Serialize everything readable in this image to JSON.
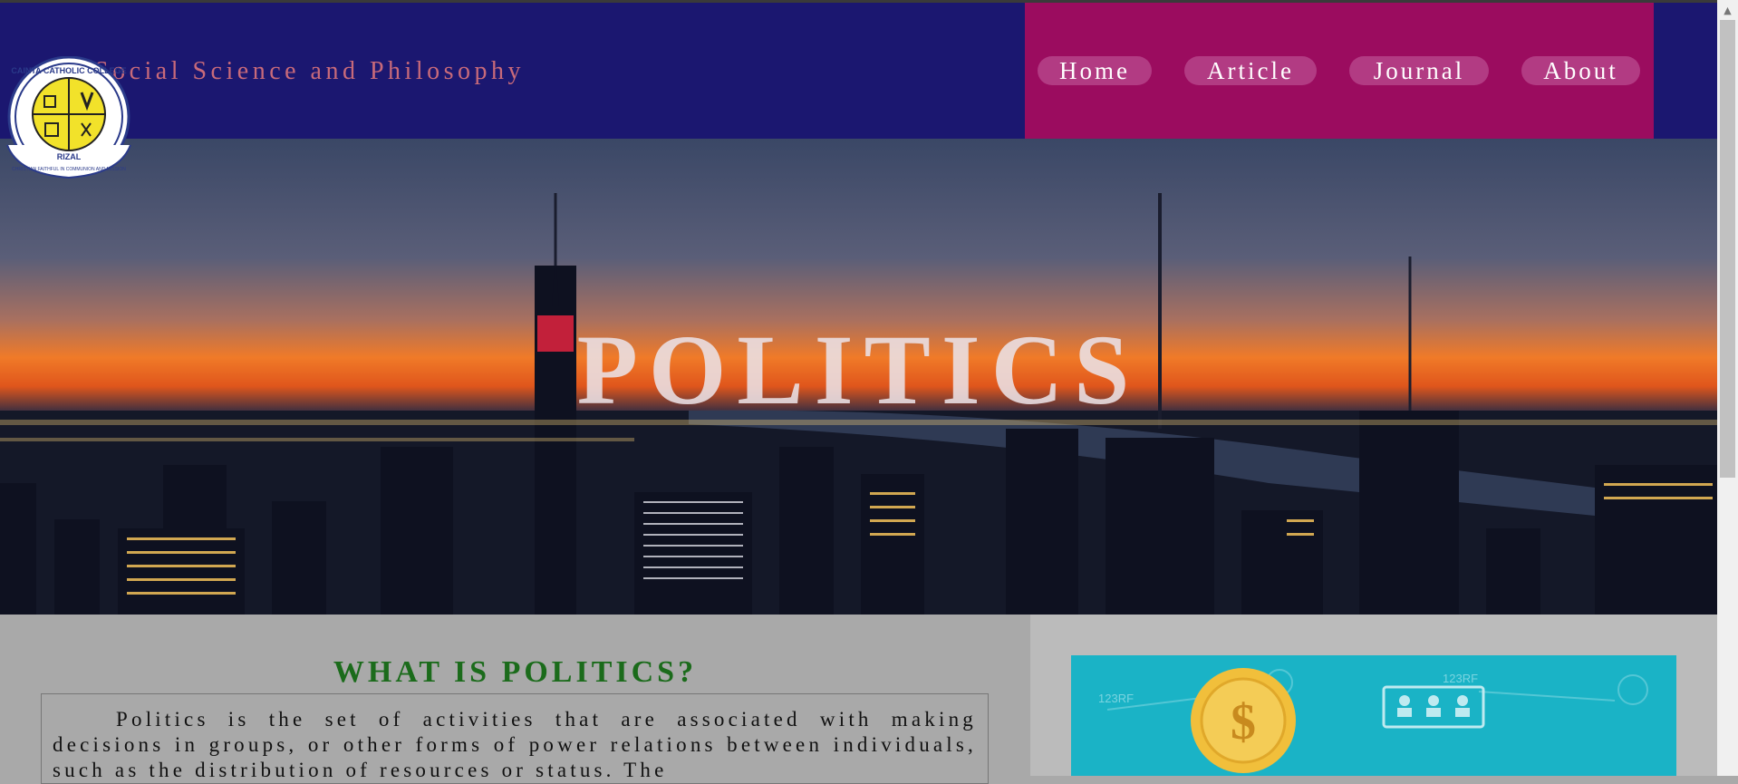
{
  "header": {
    "site_title": "Social Science and Philosophy",
    "nav": [
      {
        "label": "Home"
      },
      {
        "label": "Article"
      },
      {
        "label": "Journal"
      },
      {
        "label": "About"
      }
    ]
  },
  "logo": {
    "text_top": "CAINTA CATHOLIC COLLEGE",
    "text_bottom": "RIZAL",
    "motto": "CHRISTIAN FAITHFUL IN COMMUNION AND MISSION"
  },
  "hero": {
    "title": "POLITICS"
  },
  "main": {
    "heading": "WHAT IS POLITICS?",
    "paragraph": "Politics is the set of activities that are associated with making decisions in groups, or other forms of power relations between individuals, such as the distribution of resources or status. The"
  },
  "side_image": {
    "watermark": "123RF",
    "currency_symbol": "$"
  },
  "colors": {
    "header_bg": "#1b1770",
    "nav_panel_bg": "#9b0c5f",
    "site_title": "#c86a7a",
    "heading_green": "#1b6b1b",
    "side_image_bg": "#1ab3c6"
  }
}
